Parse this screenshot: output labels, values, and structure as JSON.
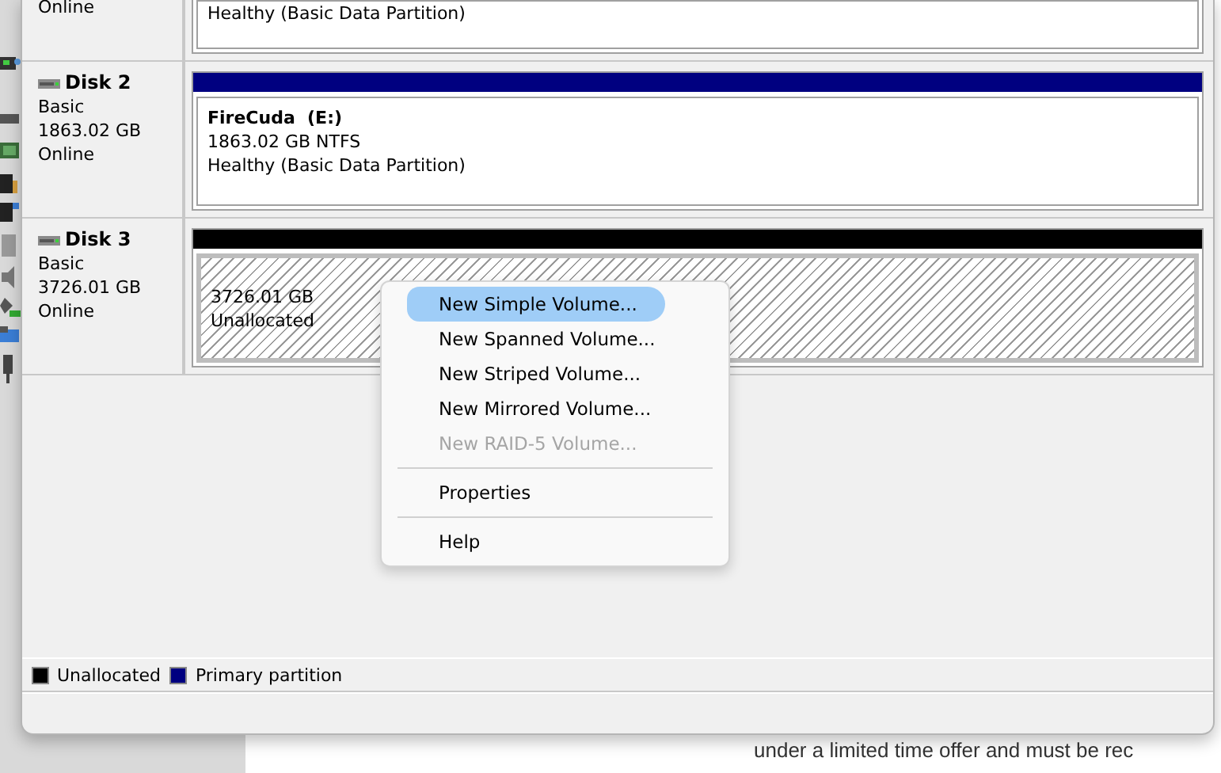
{
  "background_page": {
    "line": "under a limited time offer and must be rec"
  },
  "disks": [
    {
      "info": [
        "Online"
      ],
      "partition": {
        "kind": "primary",
        "info": [
          "Healthy (Basic Data Partition)"
        ]
      }
    },
    {
      "name": "Disk 2",
      "info": [
        "Basic",
        "1863.02 GB",
        "Online"
      ],
      "partition": {
        "kind": "primary",
        "title": "FireCuda  (E:)",
        "info": [
          "1863.02 GB NTFS",
          "Healthy (Basic Data Partition)"
        ]
      }
    },
    {
      "name": "Disk 3",
      "info": [
        "Basic",
        "3726.01 GB",
        "Online"
      ],
      "partition": {
        "kind": "unallocated",
        "info": [
          "3726.01 GB",
          "Unallocated"
        ]
      }
    }
  ],
  "context_menu": [
    {
      "kind": "item",
      "label": "New Simple Volume...",
      "selected": true,
      "disabled": false
    },
    {
      "kind": "item",
      "label": "New Spanned Volume...",
      "selected": false,
      "disabled": false
    },
    {
      "kind": "item",
      "label": "New Striped Volume...",
      "selected": false,
      "disabled": false
    },
    {
      "kind": "item",
      "label": "New Mirrored Volume...",
      "selected": false,
      "disabled": false
    },
    {
      "kind": "item",
      "label": "New RAID-5 Volume...",
      "selected": false,
      "disabled": true
    },
    {
      "kind": "separator"
    },
    {
      "kind": "item",
      "label": "Properties",
      "selected": false,
      "disabled": false
    },
    {
      "kind": "separator"
    },
    {
      "kind": "item",
      "label": "Help",
      "selected": false,
      "disabled": false
    }
  ],
  "legend": [
    {
      "label": "Unallocated",
      "color": "#000000"
    },
    {
      "label": "Primary partition",
      "color": "#000080"
    }
  ]
}
